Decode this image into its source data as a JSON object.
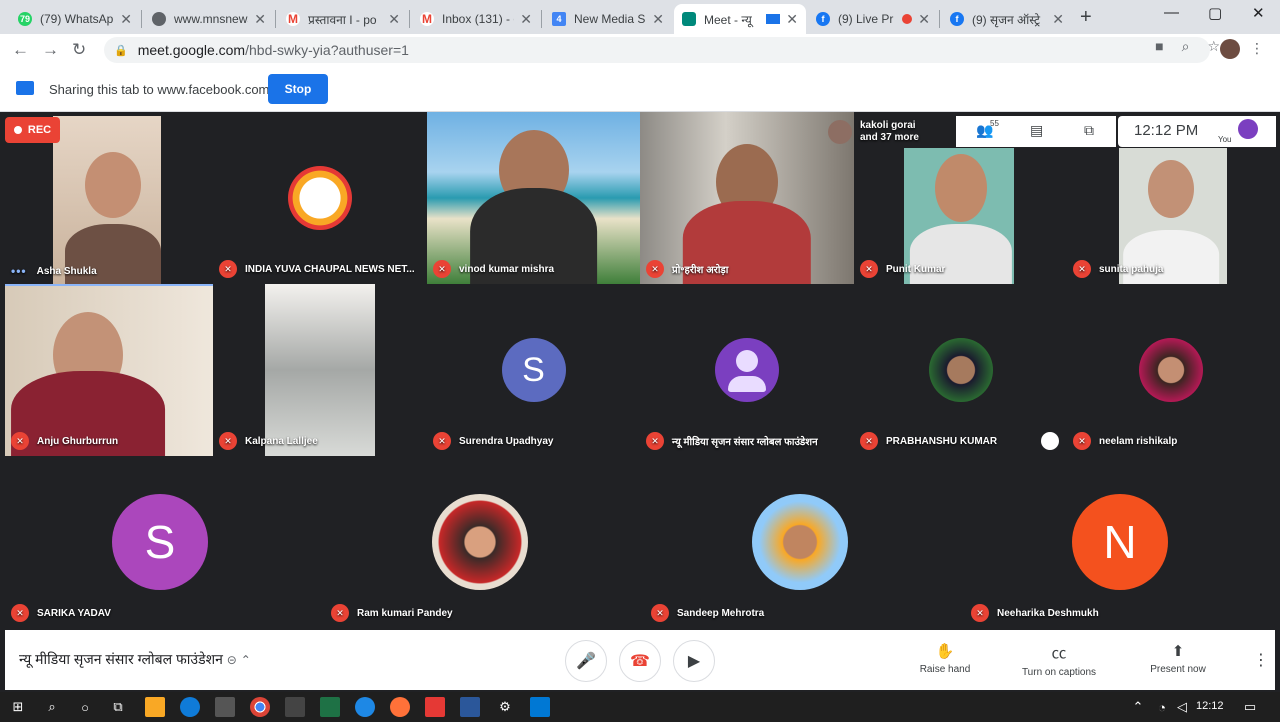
{
  "browser": {
    "tabs": [
      {
        "title": "(79) WhatsApp",
        "icon": "whatsapp-icon",
        "color": "#25d366",
        "badge": "79"
      },
      {
        "title": "www.mnsnews",
        "icon": "globe-icon",
        "color": "#5f6368",
        "badge": ""
      },
      {
        "title": "प्रस्तावना I - po",
        "icon": "gmail-icon",
        "color": "#ea4335",
        "badge": "M"
      },
      {
        "title": "Inbox (131) - e",
        "icon": "gmail-icon",
        "color": "#ea4335",
        "badge": "M"
      },
      {
        "title": "New Media Sr",
        "icon": "docs-icon",
        "color": "#4285f4",
        "badge": "4"
      },
      {
        "title": "Meet - न्यू",
        "icon": "meet-icon",
        "color": "#00897b",
        "badge": ""
      },
      {
        "title": "(9) Live Pr",
        "icon": "facebook-icon",
        "color": "#1877f2",
        "badge": "f"
      },
      {
        "title": "(9) सृजन ऑस्ट्रे",
        "icon": "facebook-icon",
        "color": "#1877f2",
        "badge": "f"
      }
    ],
    "url_host": "meet.google.com",
    "url_path": "/hbd-swky-yia?authuser=1"
  },
  "share_bar": {
    "text": "Sharing this tab to www.facebook.com",
    "stop_label": "Stop"
  },
  "meet": {
    "rec_label": "REC",
    "participant_count": "55",
    "time": "12:12 PM",
    "you_label": "You",
    "others_name": "kakoli gorai",
    "others_more": "and 37 more",
    "participants": [
      {
        "name": "Asha Shukla",
        "muted": false
      },
      {
        "name": "INDIA YUVA CHAUPAL NEWS NET...",
        "muted": true
      },
      {
        "name": "vinod kumar mishra",
        "muted": true
      },
      {
        "name": "प्रो॰हरीश अरोड़ा",
        "muted": true
      },
      {
        "name": "Punit Kumar",
        "muted": true
      },
      {
        "name": "sunita pahuja",
        "muted": true
      },
      {
        "name": "Anju Ghurburrun",
        "muted": true
      },
      {
        "name": "Kalpana Lalljee",
        "muted": true
      },
      {
        "name": "Surendra Upadhyay",
        "muted": true,
        "avatar": "S",
        "color": "#5c6bc0"
      },
      {
        "name": "न्यू मीडिया सृजन संसार ग्लोबल फाउंडेशन",
        "muted": true
      },
      {
        "name": "PRABHANSHU KUMAR",
        "muted": true
      },
      {
        "name": "neelam rishikalp",
        "muted": true
      },
      {
        "name": "SARIKA YADAV",
        "muted": true,
        "avatar": "S",
        "color": "#ab47bc"
      },
      {
        "name": "Ram kumari Pandey",
        "muted": true
      },
      {
        "name": "Sandeep Mehrotra",
        "muted": true
      },
      {
        "name": "Neeharika Deshmukh",
        "muted": true,
        "avatar": "N",
        "color": "#f4511e"
      }
    ],
    "meeting_title": "न्यू मीडिया सृजन संसार ग्लोबल फाउंडेशन",
    "actions": {
      "raise_hand": "Raise hand",
      "captions": "Turn on captions",
      "present": "Present now"
    }
  },
  "taskbar": {
    "clock": "12:12"
  }
}
